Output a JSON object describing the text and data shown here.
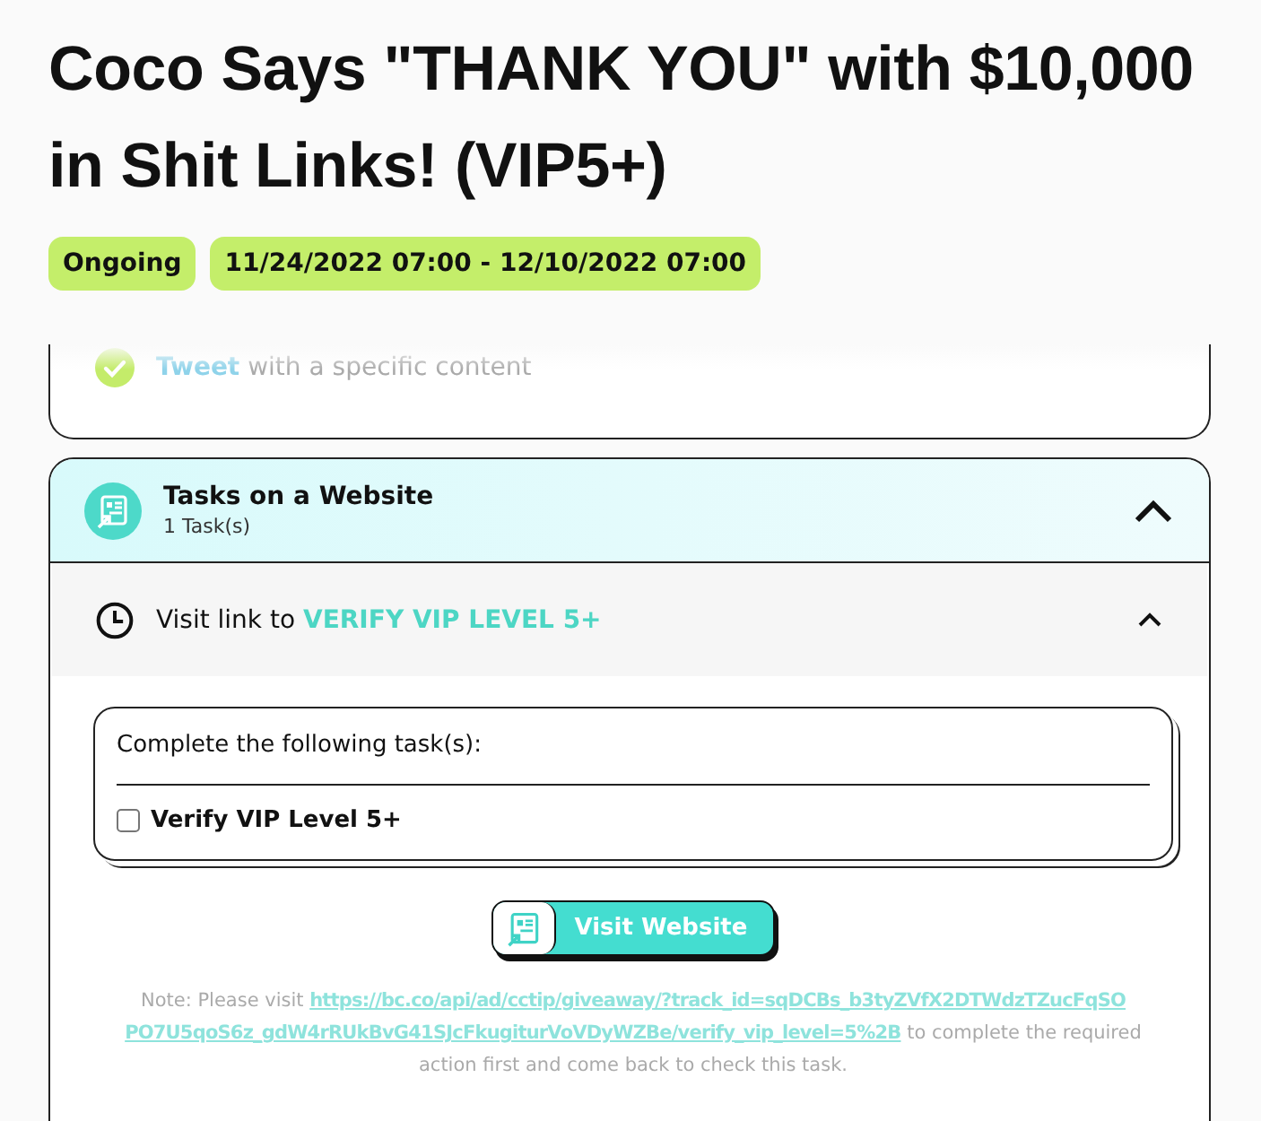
{
  "title": "Coco Says \"THANK YOU\" with $10,000 in Shit Links! (VIP5+)",
  "badges": [
    {
      "label": "Ongoing"
    },
    {
      "label": "11/24/2022 07:00 - 12/10/2022 07:00"
    }
  ],
  "previous_task": {
    "done": true,
    "action": "Tweet",
    "text": "with a specific content"
  },
  "section": {
    "title": "Tasks on a Website",
    "count": "1 Task(s)",
    "expanded": true,
    "task": {
      "prefix": "Visit link to",
      "target": "VERIFY VIP LEVEL 5+",
      "expanded": true,
      "checklist_title": "Complete the following task(s):",
      "items": [
        {
          "label": "Verify VIP Level 5+",
          "checked": false
        }
      ],
      "button": "Visit Website",
      "note": {
        "prefix": "Note: Please visit",
        "link_lines": [
          "https://bc.co/api/ad/cctip/giveaway/?track_id=sqDCBs_b3tyZVfX2DTWdzTZucFqSO",
          "PO7U5qoS6z_gdW4rRUkBvG41SJcFkugiturVoVDyWZBe/verify_vip_level=5%2B"
        ],
        "suffix": "to complete the required action first and come back to check this task."
      }
    }
  }
}
